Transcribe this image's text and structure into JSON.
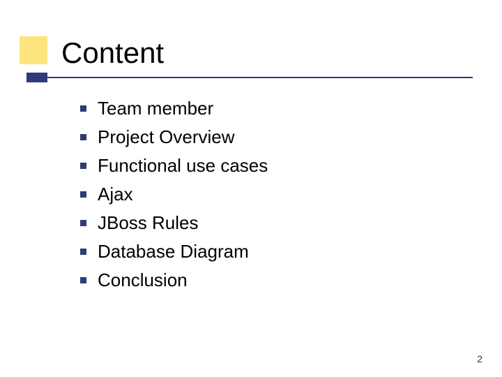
{
  "title": "Content",
  "bullets": {
    "b0": "Team member",
    "b1": "Project Overview",
    "b2": "Functional use cases",
    "b3": "Ajax",
    "b4": "JBoss Rules",
    "b5": "Database Diagram",
    "b6": "Conclusion"
  },
  "page_number": "2"
}
